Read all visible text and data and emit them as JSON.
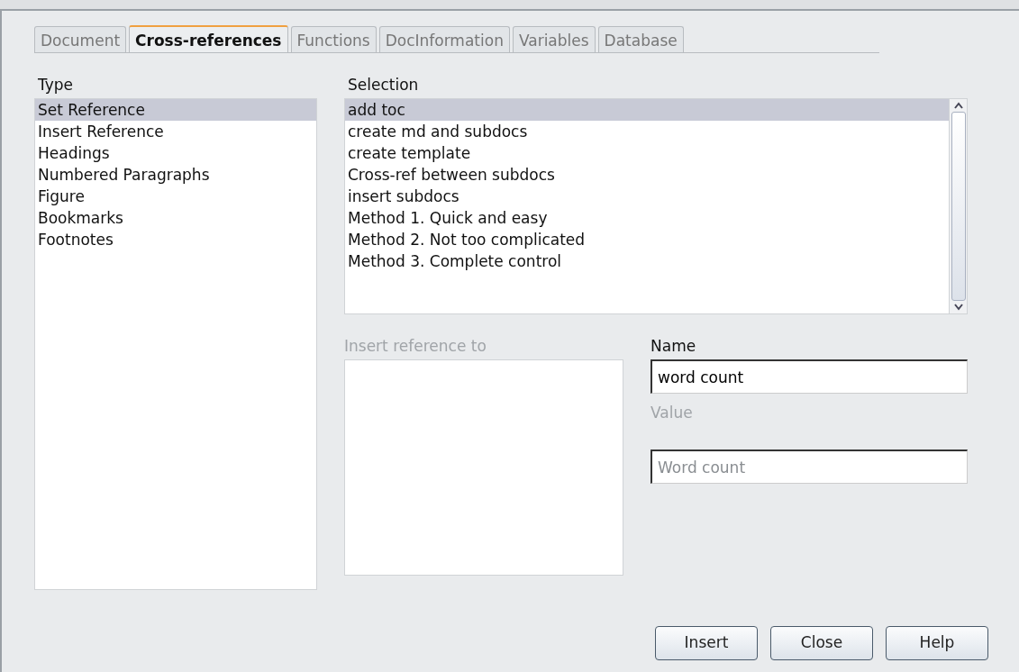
{
  "tabs": [
    {
      "label": "Document",
      "selected": false
    },
    {
      "label": "Cross-references",
      "selected": true
    },
    {
      "label": "Functions",
      "selected": false
    },
    {
      "label": "DocInformation",
      "selected": false
    },
    {
      "label": "Variables",
      "selected": false
    },
    {
      "label": "Database",
      "selected": false
    }
  ],
  "type": {
    "label": "Type",
    "items": [
      {
        "label": "Set Reference",
        "selected": true
      },
      {
        "label": "Insert Reference",
        "selected": false
      },
      {
        "label": "Headings",
        "selected": false
      },
      {
        "label": "Numbered Paragraphs",
        "selected": false
      },
      {
        "label": "Figure",
        "selected": false
      },
      {
        "label": "Bookmarks",
        "selected": false
      },
      {
        "label": "Footnotes",
        "selected": false
      }
    ]
  },
  "selection": {
    "label": "Selection",
    "items": [
      {
        "label": "add toc",
        "selected": true
      },
      {
        "label": "create md and subdocs",
        "selected": false
      },
      {
        "label": "create template",
        "selected": false
      },
      {
        "label": "Cross-ref between subdocs",
        "selected": false
      },
      {
        "label": "insert subdocs",
        "selected": false
      },
      {
        "label": "Method 1. Quick and easy",
        "selected": false
      },
      {
        "label": "Method 2. Not too complicated",
        "selected": false
      },
      {
        "label": "Method 3. Complete control",
        "selected": false
      }
    ]
  },
  "insert_reference_to": {
    "label": "Insert reference to",
    "disabled": true
  },
  "name": {
    "label": "Name",
    "value": "word count",
    "disabled": false
  },
  "value": {
    "label": "Value",
    "value": "Word count",
    "disabled": true
  },
  "buttons": [
    "Insert",
    "Close",
    "Help"
  ]
}
